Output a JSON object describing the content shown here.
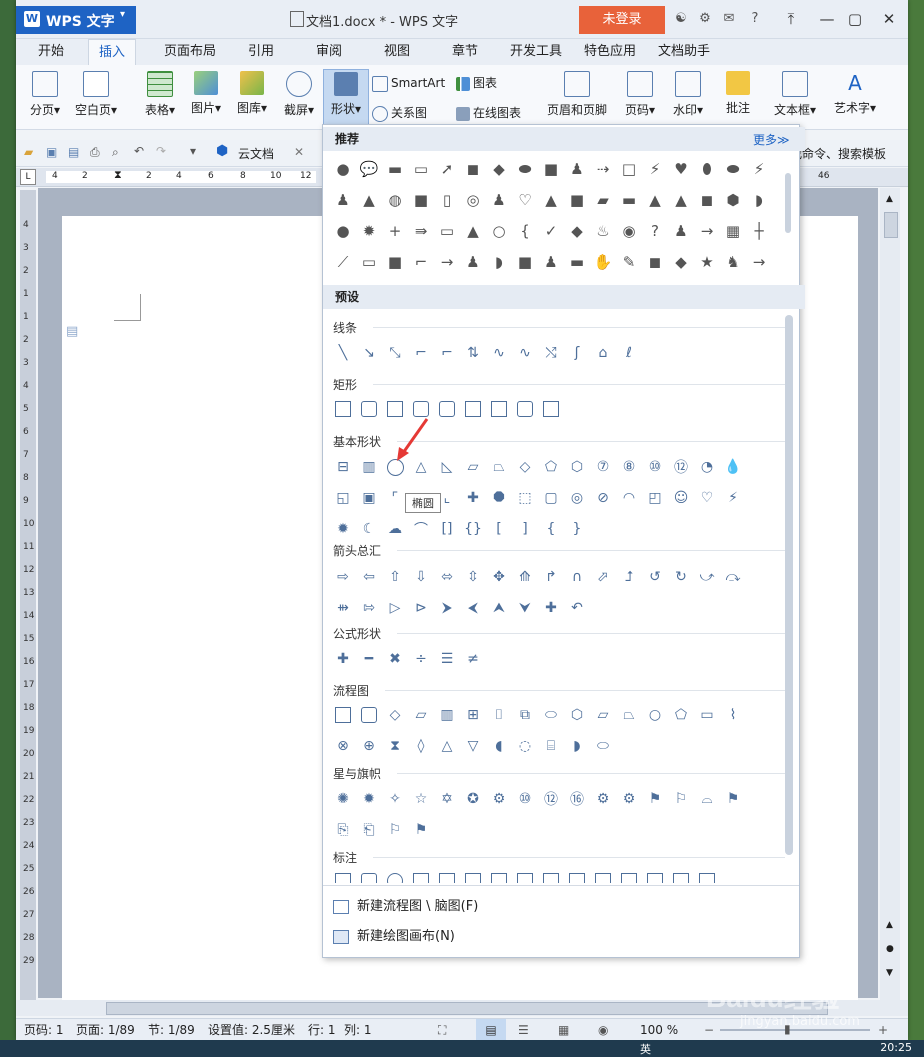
{
  "window": {
    "app_name": "WPS 文字",
    "doc_title": "文档1.docx * - WPS 文字",
    "login_label": "未登录"
  },
  "menu": {
    "items": [
      "开始",
      "插入",
      "页面布局",
      "引用",
      "审阅",
      "视图",
      "章节",
      "开发工具",
      "特色应用",
      "文档助手"
    ],
    "active": "插入"
  },
  "ribbon": {
    "page_break": "分页",
    "blank_page": "空白页",
    "table": "表格",
    "picture": "图片",
    "gallery": "图库",
    "screenshot": "截屏",
    "shapes": "形状",
    "smartart": "SmartArt",
    "chart": "图表",
    "relation": "关系图",
    "online_chart": "在线图表",
    "header_footer": "页眉和页脚",
    "page_num": "页码",
    "watermark": "水印",
    "comment": "批注",
    "textbox": "文本框",
    "wordart": "艺术字"
  },
  "quickbar": {
    "cloud_doc": "云文档",
    "search_cmd": "找命令、搜索模板"
  },
  "shapes_panel": {
    "recommended_title": "推荐",
    "more_label": "更多≫",
    "preset_title": "预设",
    "categories": [
      "线条",
      "矩形",
      "基本形状",
      "箭头总汇",
      "公式形状",
      "流程图",
      "星与旗帜",
      "标注"
    ],
    "tooltip": "椭圆",
    "new_flowchart": "新建流程图 \\ 脑图(F)",
    "new_canvas": "新建绘图画布(N)"
  },
  "statusbar": {
    "page_code": "页码: 1",
    "pages": "页面: 1/89",
    "section": "节: 1/89",
    "setting": "设置值: 2.5厘米",
    "row": "行: 1",
    "col": "列: 1",
    "zoom": "100 %"
  },
  "taskbar": {
    "lang": "英",
    "time": "20:25"
  },
  "watermark_text": "Baidu经验",
  "watermark_url": "jingyan.baidu.com",
  "ruler_marks": [
    "4",
    "2",
    "2",
    "4",
    "6",
    "8",
    "10",
    "12",
    "46"
  ],
  "vruler_marks": [
    "4",
    "3",
    "2",
    "1",
    "1",
    "2",
    "3",
    "4",
    "5",
    "6",
    "7",
    "8",
    "9",
    "10",
    "11",
    "12",
    "13",
    "14",
    "15",
    "16",
    "17",
    "18",
    "19",
    "20",
    "21",
    "22",
    "23",
    "24",
    "25",
    "26",
    "27",
    "28",
    "29"
  ],
  "colors": {
    "accent": "#1e63c4",
    "login": "#e8623a",
    "shape_stroke": "#4e6f9a"
  }
}
